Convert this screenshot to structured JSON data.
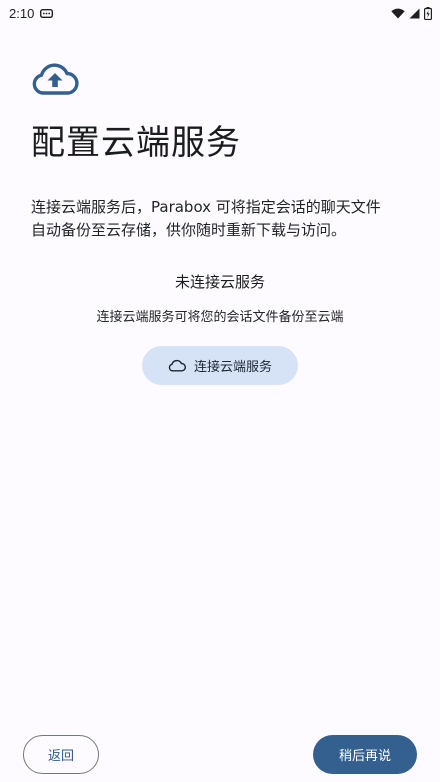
{
  "status_bar": {
    "time": "2:10",
    "icons": [
      "message-icon",
      "wifi-icon",
      "signal-icon",
      "battery-icon"
    ]
  },
  "colors": {
    "primary": "#34608f",
    "tonal_button": "#d6e3f7",
    "background": "#fdfbff",
    "outline": "#73777f"
  },
  "header": {
    "icon": "cloud-upload-icon",
    "title": "配置云端服务"
  },
  "description": {
    "line1": "连接云端服务后，Parabox 可将指定会话的聊天文件",
    "line2": "自动备份至云存储，供你随时重新下载与访问。"
  },
  "connection": {
    "status": "未连接云服务",
    "subtitle": "连接云端服务可将您的会话文件备份至云端",
    "button_icon": "cloud-icon",
    "button_label": "连接云端服务"
  },
  "footer": {
    "back_label": "返回",
    "later_label": "稍后再说"
  }
}
